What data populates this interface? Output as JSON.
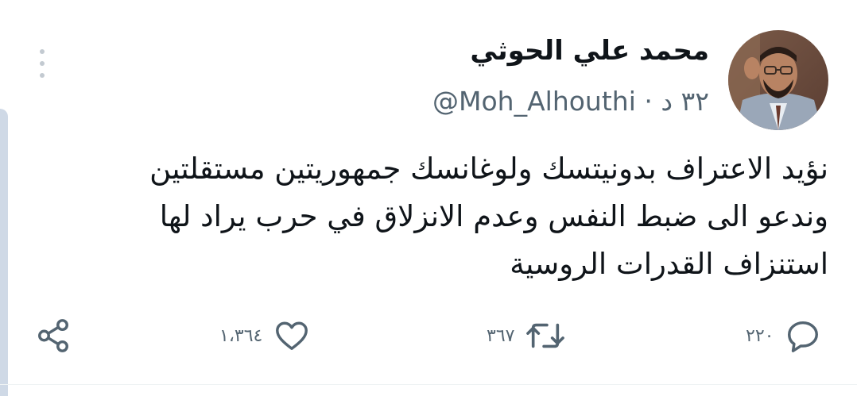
{
  "tweet": {
    "author": {
      "display_name": "محمد علي الحوثي",
      "handle": "@Moh_Alhouthi"
    },
    "separator": " · ",
    "timestamp": "٣٢ د",
    "text_lines": [
      "نؤيد الاعتراف بدونيتسك ولوغانسك جمهوريتين مستقلتين",
      "وندعو الى ضبط النفس وعدم الانزلاق في حرب يراد لها",
      "استنزاف القدرات الروسية"
    ]
  },
  "actions": {
    "replies": "٢٢٠",
    "retweets": "٣٦٧",
    "likes": "١،٣٦٤"
  },
  "icons": [
    "more-icon",
    "reply-icon",
    "retweet-icon",
    "like-icon",
    "share-icon"
  ],
  "colors": {
    "text": "#0f1419",
    "secondary": "#536471",
    "accent_bar": "#cfd9e6"
  }
}
